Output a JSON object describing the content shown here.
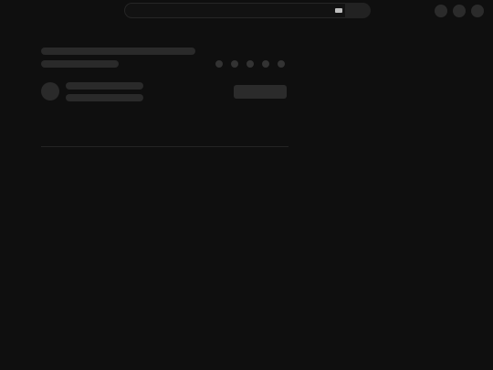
{
  "header": {
    "search": {
      "placeholder": "",
      "keyboard_icon": "keyboard-icon",
      "search_icon": "search-icon"
    },
    "actions": [
      {
        "icon": "avatar-icon"
      },
      {
        "icon": "notification-icon"
      },
      {
        "icon": "account-icon"
      }
    ]
  },
  "loading_state": {
    "title": "",
    "subtitle": "",
    "channel_name": "",
    "channel_meta": "",
    "action_label": ""
  },
  "colors": {
    "background": "#0f0f0f",
    "skeleton": "#2a2a2a",
    "dot": "#333333",
    "divider": "#232323"
  }
}
